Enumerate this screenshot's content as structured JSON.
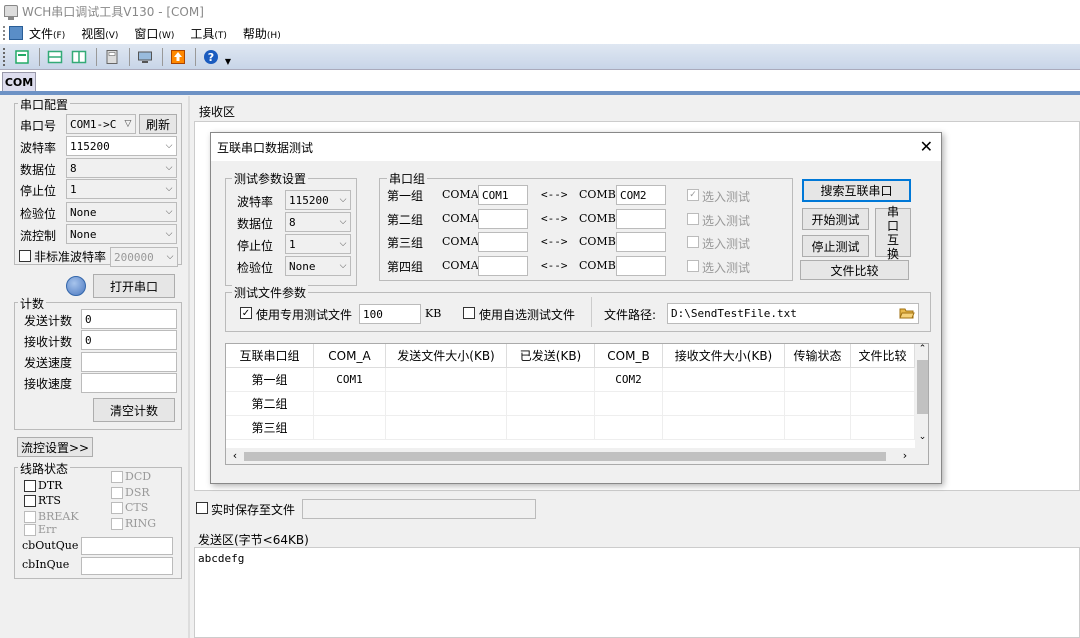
{
  "window": {
    "title": "WCH串口调试工具V130 - [COM]"
  },
  "menu": [
    {
      "label": "文件",
      "key": "(F)"
    },
    {
      "label": "视图",
      "key": "(V)"
    },
    {
      "label": "窗口",
      "key": "(W)"
    },
    {
      "label": "工具",
      "key": "(T)"
    },
    {
      "label": "帮助",
      "key": "(H)"
    }
  ],
  "tab": {
    "label": "COM"
  },
  "serial_config": {
    "title": "串口配置",
    "port_label": "串口号",
    "port_value": "COM1->C",
    "refresh_label": "刷新",
    "baud_label": "波特率",
    "baud_value": "115200",
    "data_label": "数据位",
    "data_value": "8",
    "stop_label": "停止位",
    "stop_value": "1",
    "parity_label": "检验位",
    "parity_value": "None",
    "flow_label": "流控制",
    "flow_value": "None",
    "nonstd_label": "非标准波特率",
    "nonstd_value": "200000",
    "open_label": "打开串口"
  },
  "counter": {
    "title": "计数",
    "send_count_label": "发送计数",
    "send_count_value": "0",
    "recv_count_label": "接收计数",
    "recv_count_value": "0",
    "send_speed_label": "发送速度",
    "recv_speed_label": "接收速度",
    "clear_label": "清空计数"
  },
  "flow_settings_label": "流控设置>>",
  "line_status": {
    "title": "线路状态",
    "dtr": "DTR",
    "rts": "RTS",
    "break": "BREAK",
    "err": "Err",
    "dcd": "DCD",
    "dsr": "DSR",
    "cts": "CTS",
    "ring": "RING",
    "outque": "cbOutQue",
    "inque": "cbInQue"
  },
  "receive": {
    "title": "接收区",
    "save_label": "实时保存至文件"
  },
  "send": {
    "title": "发送区(字节<64KB)",
    "content": "abcdefg"
  },
  "dialog": {
    "title": "互联串口数据测试",
    "close": "✕",
    "params": {
      "title": "测试参数设置",
      "baud_label": "波特率",
      "baud_value": "115200",
      "data_label": "数据位",
      "data_value": "8",
      "stop_label": "停止位",
      "stop_value": "1",
      "parity_label": "检验位",
      "parity_value": "None"
    },
    "port_group": {
      "title": "串口组",
      "arrow": "<-->",
      "coma_label": "COMA:",
      "comb_label": "COMB:",
      "select_label": "选入测试",
      "rows": [
        {
          "name": "第一组",
          "coma": "COM1",
          "comb": "COM2"
        },
        {
          "name": "第二组",
          "coma": "",
          "comb": ""
        },
        {
          "name": "第三组",
          "coma": "",
          "comb": ""
        },
        {
          "name": "第四组",
          "coma": "",
          "comb": ""
        }
      ]
    },
    "buttons": {
      "search": "搜索互联串口",
      "start": "开始测试",
      "stop": "停止测试",
      "swap": "串口互换",
      "compare": "文件比较"
    },
    "file_params": {
      "title": "测试文件参数",
      "use_dedicated_label": "使用专用测试文件",
      "size_value": "100",
      "size_unit": "KB",
      "use_custom_label": "使用自选测试文件",
      "path_label": "文件路径:",
      "path_value": "D:\\SendTestFile.txt"
    },
    "table": {
      "headers": [
        "互联串口组",
        "COM_A",
        "发送文件大小(KB)",
        "已发送(KB)",
        "COM_B",
        "接收文件大小(KB)",
        "传输状态",
        "文件比较"
      ],
      "rows": [
        [
          "第一组",
          "COM1",
          "",
          "",
          "COM2",
          "",
          "",
          ""
        ],
        [
          "第二组",
          "",
          "",
          "",
          "",
          "",
          "",
          ""
        ],
        [
          "第三组",
          "",
          "",
          "",
          "",
          "",
          "",
          ""
        ]
      ]
    }
  }
}
